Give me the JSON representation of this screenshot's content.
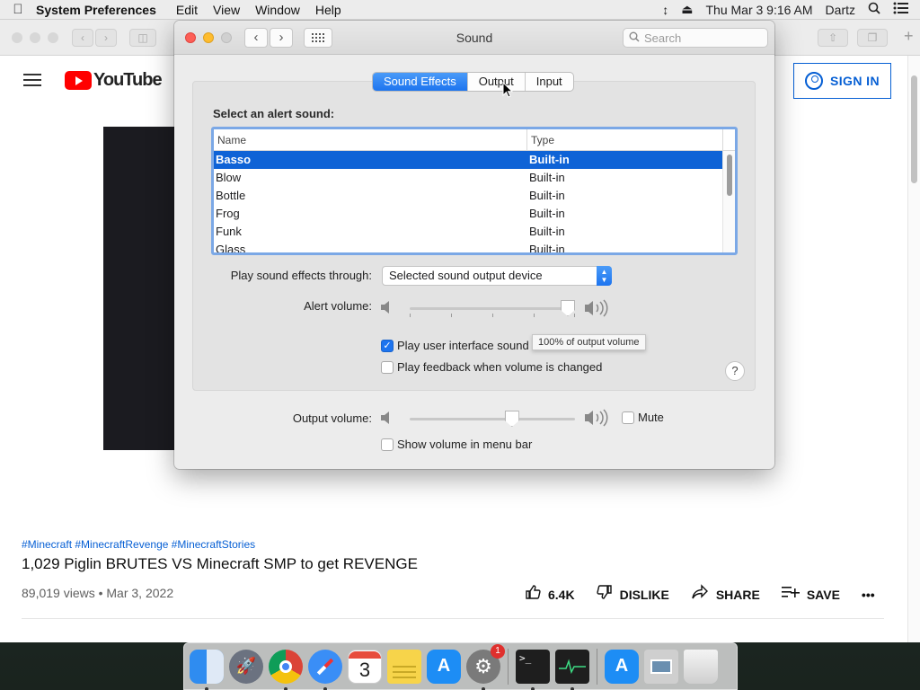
{
  "menubar": {
    "app_name": "System Preferences",
    "items": [
      "Edit",
      "View",
      "Window",
      "Help"
    ],
    "date_time": "Thu Mar 3  9:16 AM",
    "user": "Dartz"
  },
  "browser": {
    "youtube": {
      "logo_text": "YouTube",
      "sign_in_label": "SIGN IN",
      "tags": "#Minecraft #MinecraftRevenge #MinecraftStories",
      "title": "1,029 Piglin BRUTES VS Minecraft SMP to get REVENGE",
      "meta": "89,019 views • Mar 3, 2022",
      "like_count": "6.4K",
      "dislike_label": "DISLIKE",
      "share_label": "SHARE",
      "save_label": "SAVE",
      "more_label": "•••"
    }
  },
  "sound_window": {
    "title": "Sound",
    "search_placeholder": "Search",
    "tabs": [
      {
        "label": "Sound Effects",
        "active": true
      },
      {
        "label": "Output",
        "active": false
      },
      {
        "label": "Input",
        "active": false
      }
    ],
    "alert_label": "Select an alert sound:",
    "table": {
      "columns": [
        "Name",
        "Type"
      ],
      "rows": [
        {
          "name": "Basso",
          "type": "Built-in",
          "selected": true
        },
        {
          "name": "Blow",
          "type": "Built-in"
        },
        {
          "name": "Bottle",
          "type": "Built-in"
        },
        {
          "name": "Frog",
          "type": "Built-in"
        },
        {
          "name": "Funk",
          "type": "Built-in"
        },
        {
          "name": "Glass",
          "type": "Built-in"
        }
      ]
    },
    "play_through_label": "Play sound effects through:",
    "play_through_value": "Selected sound output device",
    "alert_volume_label": "Alert volume:",
    "alert_volume_fraction": 1.0,
    "alert_volume_tooltip": "100% of output volume",
    "ui_sound_effects_label": "Play user interface sound effects",
    "ui_sound_effects_checked": true,
    "feedback_label": "Play feedback when volume is changed",
    "feedback_checked": false,
    "help_label": "?",
    "output_volume_label": "Output volume:",
    "output_volume_fraction": 0.63,
    "mute_label": "Mute",
    "mute_checked": false,
    "menu_bar_label": "Show volume in menu bar",
    "menu_bar_checked": false
  },
  "dock": {
    "items": [
      {
        "icon": "finder-icon",
        "color": "#2f8cf0"
      },
      {
        "icon": "launchpad-icon",
        "color": "#6b7280"
      },
      {
        "icon": "chrome-icon",
        "color": "#ffffff"
      },
      {
        "icon": "safari-icon",
        "color": "#3a8ef6"
      },
      {
        "icon": "calendar-icon",
        "color": "#ffffff",
        "text": "3"
      },
      {
        "icon": "notes-icon",
        "color": "#f7d44a"
      },
      {
        "icon": "app-store-icon",
        "color": "#1d8df5"
      },
      {
        "icon": "system-preferences-icon",
        "color": "#7a7a7a",
        "badge": "1"
      },
      {
        "icon": "terminal-icon",
        "color": "#1e1e1e"
      },
      {
        "icon": "activity-monitor-icon",
        "color": "#1e1e1e"
      },
      {
        "icon": "app-store-downloads-icon",
        "color": "#1d8df5"
      },
      {
        "icon": "preview-icon",
        "color": "#cfcfcf"
      },
      {
        "icon": "trash-icon",
        "color": "#e6e6e6"
      }
    ]
  }
}
